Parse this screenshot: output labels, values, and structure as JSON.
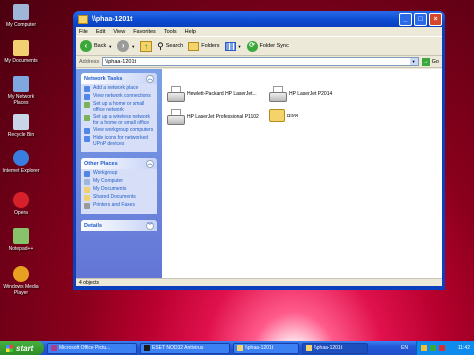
{
  "desktop": {
    "icons": [
      {
        "label": "My Computer",
        "icon": "my-computer-icon",
        "color": "#9fb6d9"
      },
      {
        "label": "My Documents",
        "icon": "my-documents-icon",
        "color": "#f0d070"
      },
      {
        "label": "My Network Places",
        "icon": "network-icon",
        "color": "#7fa8e0"
      },
      {
        "label": "Recycle Bin",
        "icon": "recycle-bin-icon",
        "color": "#c9d6e8"
      },
      {
        "label": "Internet Explorer",
        "icon": "internet-explorer-icon",
        "color": "#3a7de0"
      },
      {
        "label": "Opera",
        "icon": "opera-icon",
        "color": "#d8202a"
      },
      {
        "label": "Notepad++",
        "icon": "notepadpp-icon",
        "color": "#86c36a"
      },
      {
        "label": "Windows Media Player",
        "icon": "media-player-icon",
        "color": "#e8a020"
      }
    ]
  },
  "window": {
    "title": "\\\\phaa-1201t",
    "menu": [
      "File",
      "Edit",
      "View",
      "Favorites",
      "Tools",
      "Help"
    ],
    "toolbar": {
      "back": "Back",
      "search": "Search",
      "folders": "Folders",
      "folder_sync": "Folder Sync"
    },
    "address": {
      "label": "Address",
      "value": "\\\\phaa-1201t",
      "go": "Go"
    },
    "network_tasks": {
      "title": "Network Tasks",
      "items": [
        "Add a network place",
        "View network connections",
        "Set up a home or small office network",
        "Set up a wireless network for a home or small office",
        "View workgroup computers",
        "Hide icons for networked UPnP devices"
      ]
    },
    "other_places": {
      "title": "Other Places",
      "items": [
        "Workgroup",
        "My Computer",
        "My Documents",
        "Shared Documents",
        "Printers and Faxes"
      ]
    },
    "details": {
      "title": "Details"
    },
    "files": [
      {
        "name": "Hewlett-Packard HP LaserJet...",
        "type": "printer"
      },
      {
        "name": "HP LaserJet P2014",
        "type": "printer"
      },
      {
        "name": "HP LaserJet Professional P1102",
        "type": "printer"
      },
      {
        "name": "איגום",
        "type": "share"
      }
    ],
    "status": "4 objects"
  },
  "taskbar": {
    "start": "start",
    "buttons": [
      "Microsoft Office Pictu...",
      "ESET NOD32 Antivirus",
      "\\\\phaa-1201t",
      "\\\\phaa-1201t"
    ],
    "active_index": 3,
    "lang": "EN",
    "clock": "11:42"
  }
}
